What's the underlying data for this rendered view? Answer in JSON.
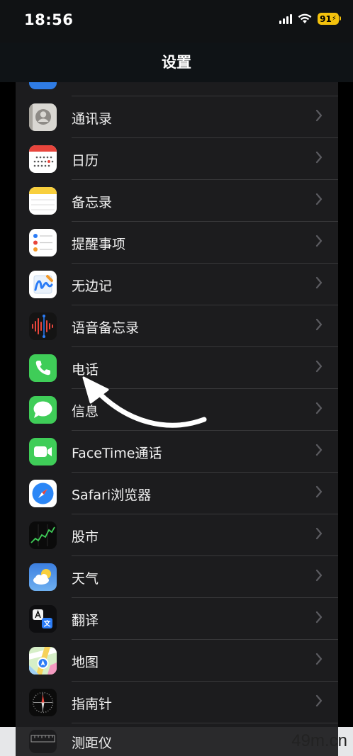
{
  "status_bar": {
    "time": "18:56",
    "battery": "91"
  },
  "nav": {
    "title": "设置"
  },
  "rows": [
    {
      "label": "通讯录",
      "icon": "contacts-icon"
    },
    {
      "label": "日历",
      "icon": "calendar-icon"
    },
    {
      "label": "备忘录",
      "icon": "notes-icon"
    },
    {
      "label": "提醒事项",
      "icon": "reminders-icon"
    },
    {
      "label": "无边记",
      "icon": "freeform-icon"
    },
    {
      "label": "语音备忘录",
      "icon": "voice-memos-icon"
    },
    {
      "label": "电话",
      "icon": "phone-icon"
    },
    {
      "label": "信息",
      "icon": "messages-icon"
    },
    {
      "label": "FaceTime通话",
      "icon": "facetime-icon"
    },
    {
      "label": "Safari浏览器",
      "icon": "safari-icon"
    },
    {
      "label": "股市",
      "icon": "stocks-icon"
    },
    {
      "label": "天气",
      "icon": "weather-icon"
    },
    {
      "label": "翻译",
      "icon": "translate-icon"
    },
    {
      "label": "地图",
      "icon": "maps-icon"
    },
    {
      "label": "指南针",
      "icon": "compass-icon"
    }
  ],
  "bottom_row": {
    "label": "测距仪",
    "icon": "measure-icon"
  },
  "watermark": "49m.cn",
  "colors": {
    "background": "#000000",
    "panel": "#1c1c1e",
    "separator": "#38383a",
    "battery": "#f4c20d"
  }
}
